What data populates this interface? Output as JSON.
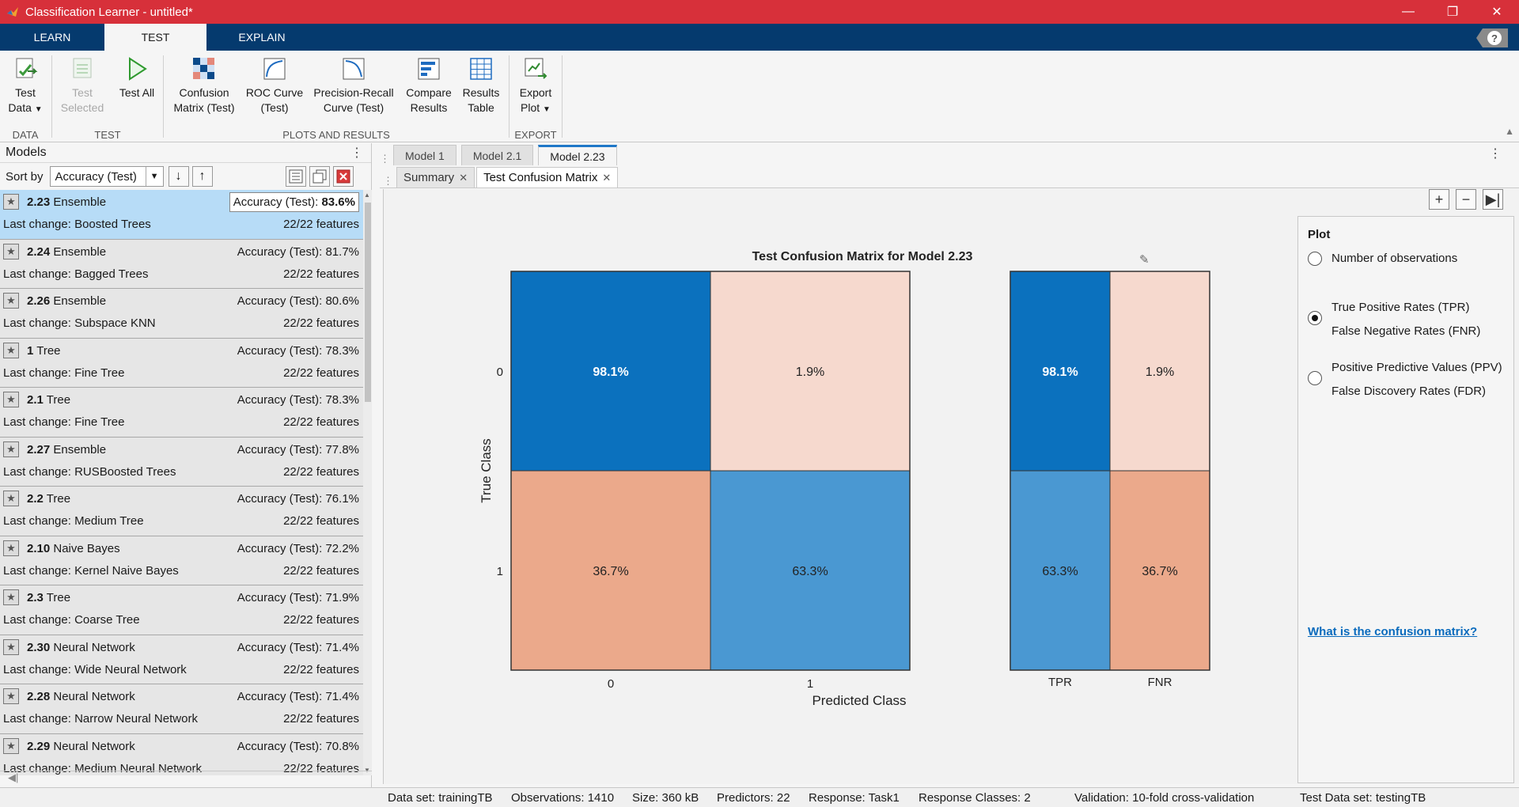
{
  "window": {
    "title": "Classification Learner - untitled*"
  },
  "ribbon": {
    "tabs": [
      "LEARN",
      "TEST",
      "EXPLAIN"
    ],
    "active_tab": "TEST",
    "groups": {
      "data": {
        "label": "DATA",
        "test_data": [
          "Test",
          "Data"
        ]
      },
      "test": {
        "label": "TEST",
        "test_selected": [
          "Test",
          "Selected"
        ],
        "test_all": "Test All"
      },
      "plots": {
        "label": "PLOTS AND RESULTS",
        "confusion": [
          "Confusion",
          "Matrix (Test)"
        ],
        "roc": [
          "ROC Curve",
          "(Test)"
        ],
        "pr": [
          "Precision-Recall",
          "Curve (Test)"
        ],
        "compare": [
          "Compare",
          "Results"
        ],
        "results_table": [
          "Results",
          "Table"
        ]
      },
      "export": {
        "label": "EXPORT",
        "export_plot": [
          "Export",
          "Plot"
        ]
      }
    }
  },
  "models_panel": {
    "title": "Models",
    "sort_label": "Sort by",
    "sort_value": "Accuracy (Test)",
    "items": [
      {
        "id": "2.23",
        "type": "Ensemble",
        "accuracy": "Accuracy (Test): 83.6%",
        "acc_prefix": "Accuracy (Test): ",
        "acc_value": "83.6%",
        "last_change": "Last change: Boosted Trees",
        "features": "22/22 features",
        "selected": true
      },
      {
        "id": "2.24",
        "type": "Ensemble",
        "accuracy": "Accuracy (Test): 81.7%",
        "last_change": "Last change: Bagged Trees",
        "features": "22/22 features"
      },
      {
        "id": "2.26",
        "type": "Ensemble",
        "accuracy": "Accuracy (Test): 80.6%",
        "last_change": "Last change: Subspace KNN",
        "features": "22/22 features"
      },
      {
        "id": "1",
        "type": "Tree",
        "accuracy": "Accuracy (Test): 78.3%",
        "last_change": "Last change: Fine Tree",
        "features": "22/22 features"
      },
      {
        "id": "2.1",
        "type": "Tree",
        "accuracy": "Accuracy (Test): 78.3%",
        "last_change": "Last change: Fine Tree",
        "features": "22/22 features"
      },
      {
        "id": "2.27",
        "type": "Ensemble",
        "accuracy": "Accuracy (Test): 77.8%",
        "last_change": "Last change: RUSBoosted Trees",
        "features": "22/22 features"
      },
      {
        "id": "2.2",
        "type": "Tree",
        "accuracy": "Accuracy (Test): 76.1%",
        "last_change": "Last change: Medium Tree",
        "features": "22/22 features"
      },
      {
        "id": "2.10",
        "type": "Naive Bayes",
        "accuracy": "Accuracy (Test): 72.2%",
        "last_change": "Last change: Kernel Naive Bayes",
        "features": "22/22 features"
      },
      {
        "id": "2.3",
        "type": "Tree",
        "accuracy": "Accuracy (Test): 71.9%",
        "last_change": "Last change: Coarse Tree",
        "features": "22/22 features"
      },
      {
        "id": "2.30",
        "type": "Neural Network",
        "accuracy": "Accuracy (Test): 71.4%",
        "last_change": "Last change: Wide Neural Network",
        "features": "22/22 features"
      },
      {
        "id": "2.28",
        "type": "Neural Network",
        "accuracy": "Accuracy (Test): 71.4%",
        "last_change": "Last change: Narrow Neural Network",
        "features": "22/22 features"
      },
      {
        "id": "2.29",
        "type": "Neural Network",
        "accuracy": "Accuracy (Test): 70.8%",
        "last_change": "Last change: Medium Neural Network",
        "features": "22/22 features"
      }
    ]
  },
  "doc_tabs": [
    "Model 1",
    "Model 2.1",
    "Model 2.23"
  ],
  "active_doc_tab": "Model 2.23",
  "sub_tabs": [
    "Summary",
    "Test Confusion Matrix"
  ],
  "active_sub_tab": "Test Confusion Matrix",
  "chart_data": {
    "type": "heatmap",
    "title": "Test Confusion Matrix for Model 2.23",
    "xlabel": "Predicted Class",
    "ylabel": "True Class",
    "true_classes": [
      "0",
      "1"
    ],
    "predicted_classes": [
      "0",
      "1"
    ],
    "matrix_percent": [
      [
        98.1,
        1.9
      ],
      [
        36.7,
        63.3
      ]
    ],
    "matrix_labels": [
      [
        "98.1%",
        "1.9%"
      ],
      [
        "36.7%",
        "63.3%"
      ]
    ],
    "summary_columns": [
      "TPR",
      "FNR"
    ],
    "summary_percent": [
      [
        98.1,
        1.9
      ],
      [
        63.3,
        36.7
      ]
    ],
    "summary_labels": [
      [
        "98.1%",
        "1.9%"
      ],
      [
        "63.3%",
        "36.7%"
      ]
    ],
    "colors": {
      "diag_strong": "#0b71be",
      "diag_light": "#4a98d2",
      "off_light": "#f6d9ce",
      "off_strong": "#eba98b"
    }
  },
  "plot_options": {
    "heading": "Plot",
    "options": [
      {
        "lines": [
          "Number of observations"
        ],
        "selected": false
      },
      {
        "lines": [
          "True Positive Rates (TPR)",
          "False Negative Rates (FNR)"
        ],
        "selected": true
      },
      {
        "lines": [
          "Positive Predictive Values (PPV)",
          "False Discovery Rates (FDR)"
        ],
        "selected": false
      }
    ],
    "link": "What is the confusion matrix?"
  },
  "status_bar": {
    "dataset": "Data set: trainingTB",
    "observations": "Observations: 1410",
    "size": "Size: 360 kB",
    "predictors": "Predictors: 22",
    "response": "Response: Task1",
    "response_classes": "Response Classes: 2",
    "validation": "Validation: 10-fold cross-validation",
    "test_dataset": "Test Data set: testingTB"
  }
}
